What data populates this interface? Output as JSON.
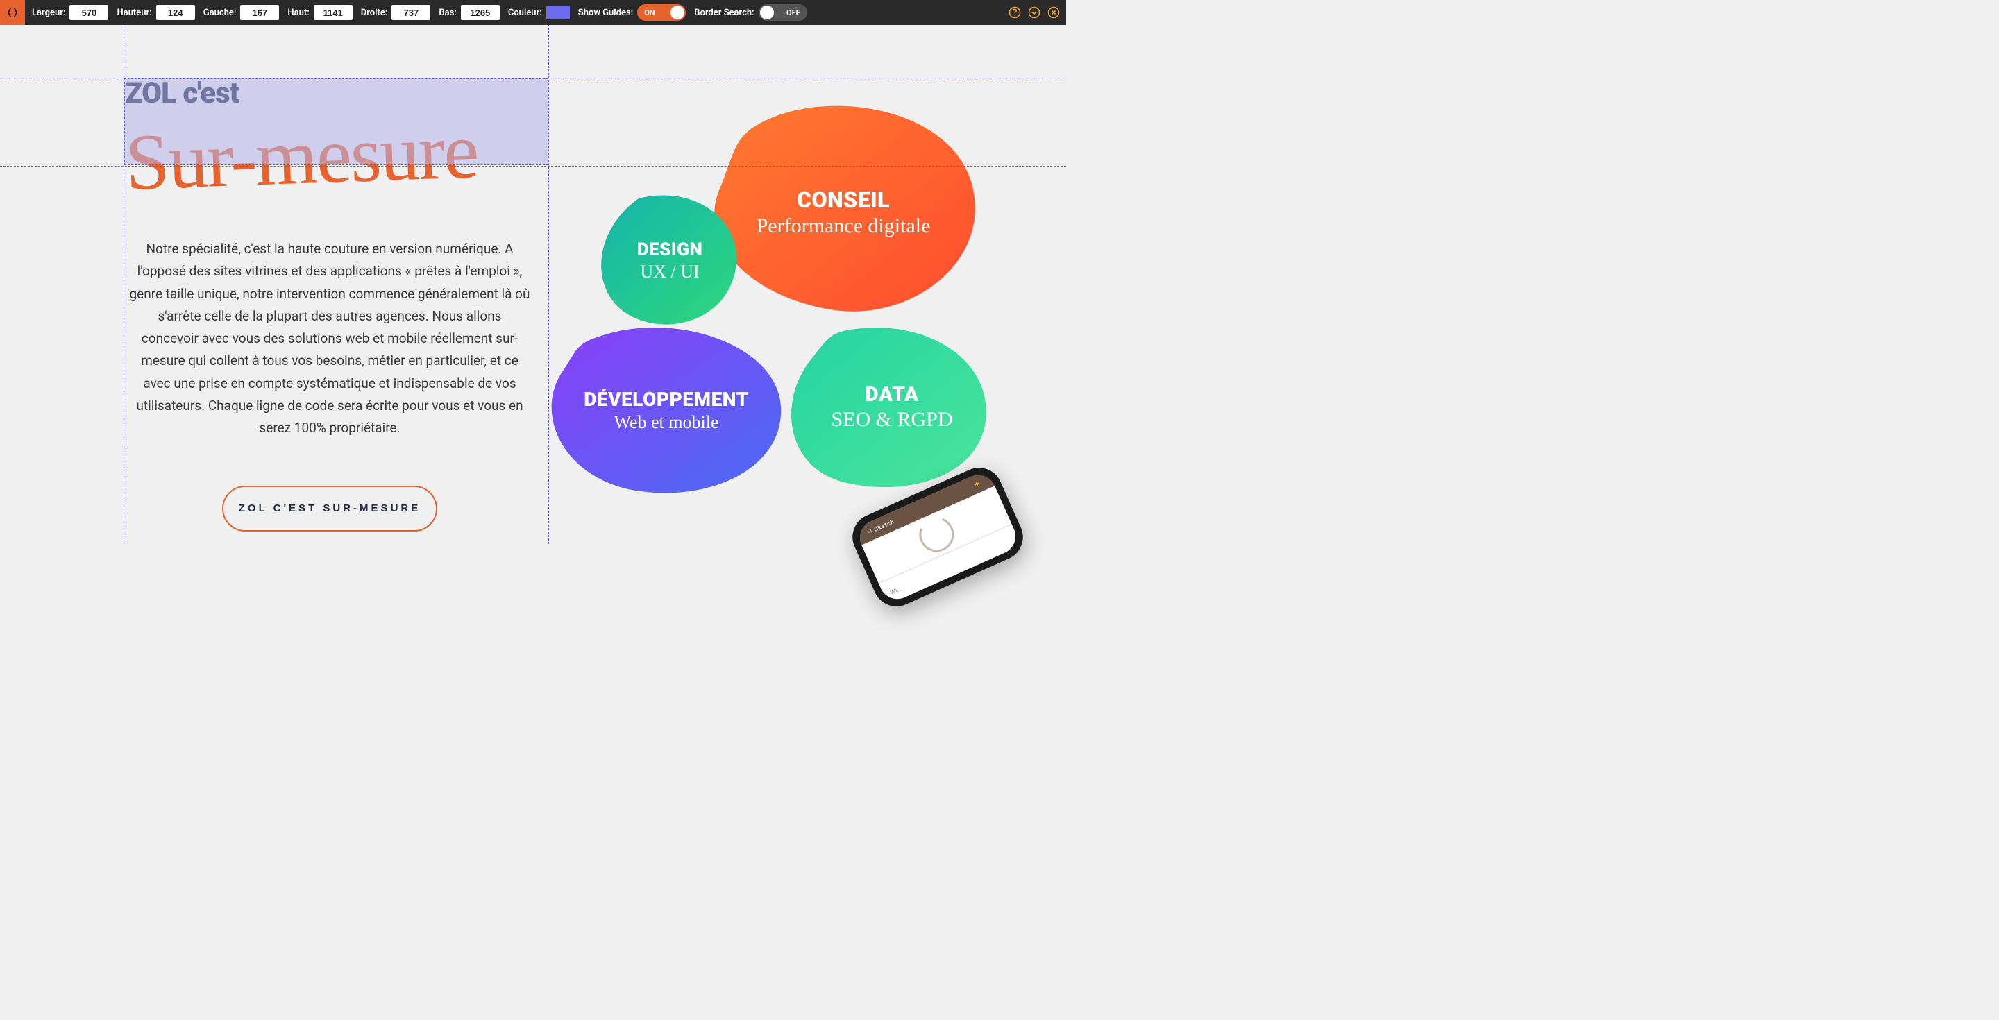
{
  "toolbar": {
    "largeur": {
      "label": "Largeur:",
      "value": "570"
    },
    "hauteur": {
      "label": "Hauteur:",
      "value": "124"
    },
    "gauche": {
      "label": "Gauche:",
      "value": "167"
    },
    "haut": {
      "label": "Haut:",
      "value": "1141"
    },
    "droite": {
      "label": "Droite:",
      "value": "737"
    },
    "bas": {
      "label": "Bas:",
      "value": "1265"
    },
    "couleur": {
      "label": "Couleur:",
      "swatch": "#6b6beb"
    },
    "show_guides": {
      "label": "Show Guides:",
      "state": "ON"
    },
    "border_search": {
      "label": "Border Search:",
      "state": "OFF"
    }
  },
  "hero": {
    "heading_plain": "ZOL c'est",
    "heading_script": "Sur-mesure",
    "body": "Notre spécialité, c'est la haute couture en version numérique. A l'opposé des sites vitrines et des applications « prêtes à l'emploi », genre taille unique, notre intervention commence généralement là où s'arrête celle de la plupart des autres agences. Nous allons concevoir avec vous des solutions web et mobile réellement sur-mesure qui collent à tous vos besoins, métier en particulier, et ce avec une prise en compte systématique et indispensable de vos utilisateurs. Chaque ligne de code sera écrite pour vous et vous en serez 100% propriétaire.",
    "cta": "ZOL C'EST SUR-MESURE"
  },
  "blobs": {
    "design": {
      "title": "DESIGN",
      "sub": "UX / UI"
    },
    "conseil": {
      "title": "CONSEIL",
      "sub": "Performance digitale"
    },
    "dev": {
      "title": "DÉVELOPPEMENT",
      "sub": "Web et mobile"
    },
    "data": {
      "title": "DATA",
      "sub": "SEO & RGPD"
    }
  },
  "phone": {
    "status_left": "•| Sketch",
    "status_right": "⚡",
    "bottom": "Wi..."
  }
}
